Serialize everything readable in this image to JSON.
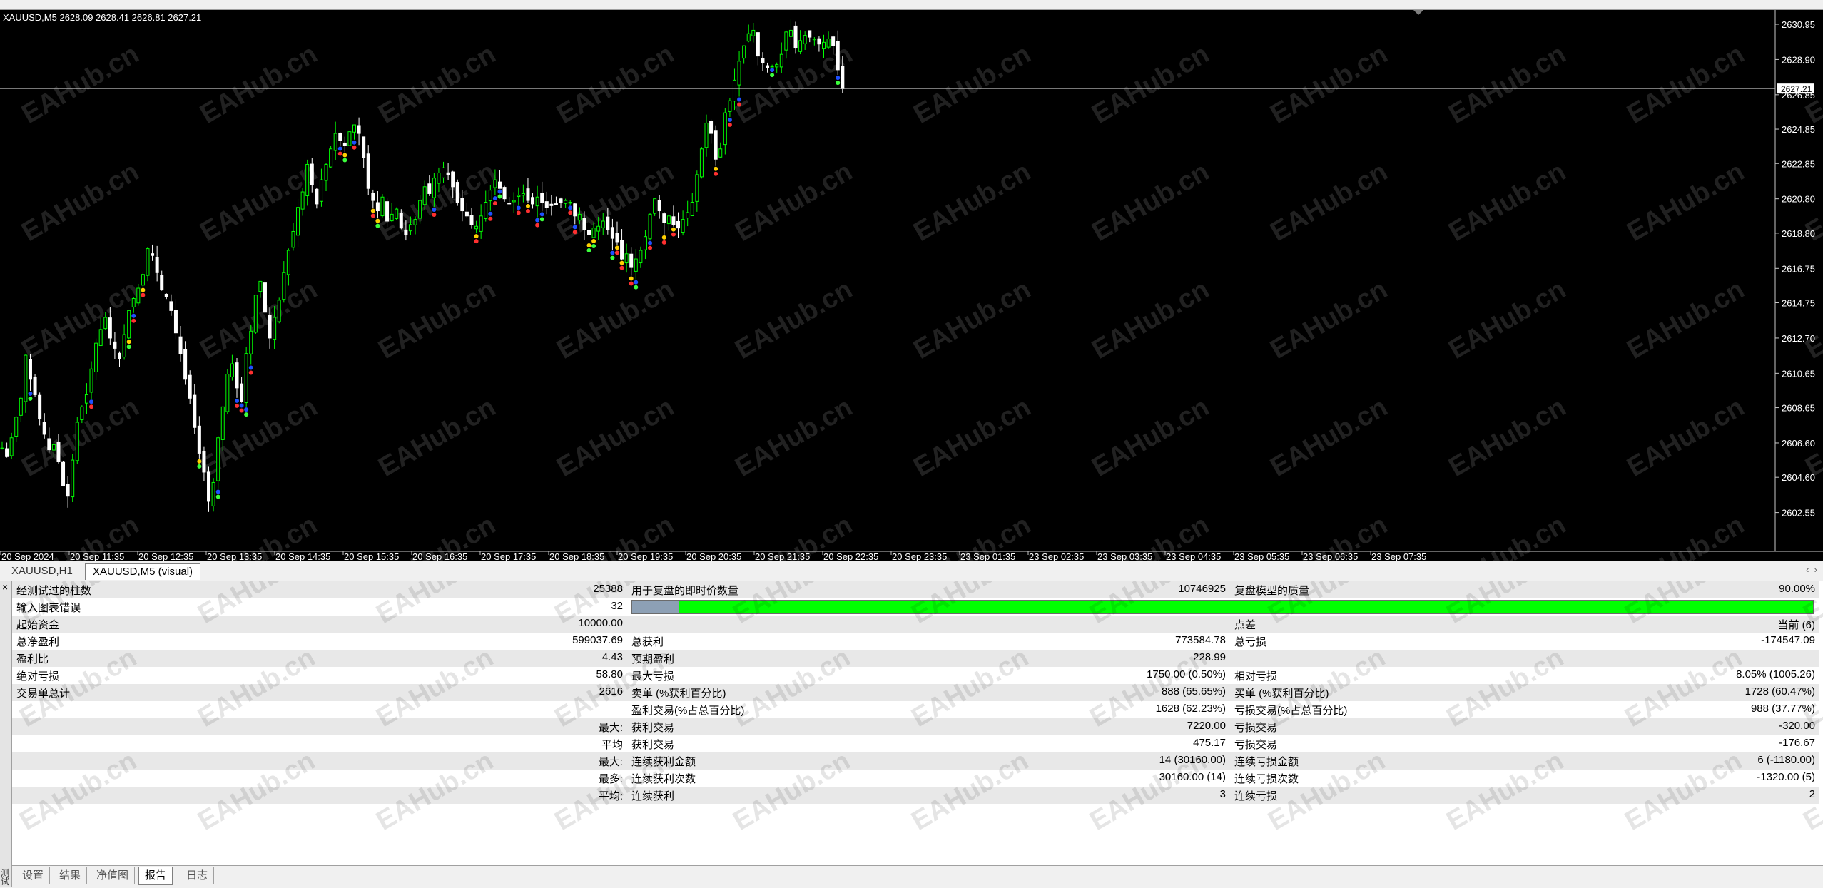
{
  "chart": {
    "symbol_info": "XAUUSD,M5  2628.09 2628.41 2626.81 2627.21",
    "current_price_label": "2627.21",
    "price_axis": [
      "2630.95",
      "2628.90",
      "2626.85",
      "2624.85",
      "2622.85",
      "2620.80",
      "2618.80",
      "2616.75",
      "2614.75",
      "2612.70",
      "2610.65",
      "2608.65",
      "2606.60",
      "2604.60",
      "2602.55"
    ],
    "time_axis": [
      "20 Sep 2024",
      "20 Sep 11:35",
      "20 Sep 12:35",
      "20 Sep 13:35",
      "20 Sep 14:35",
      "20 Sep 15:35",
      "20 Sep 16:35",
      "20 Sep 17:35",
      "20 Sep 18:35",
      "20 Sep 19:35",
      "20 Sep 20:35",
      "20 Sep 21:35",
      "20 Sep 22:35",
      "20 Sep 23:35",
      "23 Sep 01:35",
      "23 Sep 02:35",
      "23 Sep 03:35",
      "23 Sep 04:35",
      "23 Sep 05:35",
      "23 Sep 06:35",
      "23 Sep 07:35"
    ],
    "watermark": "EAHub.cn",
    "colors": {
      "background": "#000000",
      "candle_up": "#00ff00",
      "candle_down": "#ffffff",
      "buy_marker": "#1e50ff",
      "sell_marker": "#ff3030"
    },
    "close_path": [
      2606.3,
      2605.8,
      2606.9,
      2608.1,
      2609.2,
      2611.7,
      2610.3,
      2609.4,
      2608.0,
      2607.1,
      2606.2,
      2606.5,
      2605.5,
      2604.1,
      2603.5,
      2605.6,
      2607.8,
      2608.7,
      2609.4,
      2610.9,
      2612.4,
      2613.2,
      2613.9,
      2612.7,
      2612.1,
      2611.5,
      2612.9,
      2614.3,
      2615.0,
      2615.6,
      2616.4,
      2617.9,
      2617.5,
      2616.5,
      2615.5,
      2615.1,
      2614.3,
      2613.0,
      2611.8,
      2610.3,
      2609.2,
      2607.5,
      2606.0,
      2604.9,
      2603.2,
      2604.3,
      2606.9,
      2608.7,
      2610.6,
      2611.2,
      2609.8,
      2609.0,
      2611.8,
      2613.1,
      2615.2,
      2616.0,
      2614.2,
      2612.7,
      2613.9,
      2614.9,
      2616.5,
      2617.8,
      2618.9,
      2620.3,
      2621.2,
      2622.8,
      2621.6,
      2620.5,
      2621.9,
      2622.8,
      2623.7,
      2624.6,
      2624.2,
      2623.9,
      2624.7,
      2625.1,
      2624.6,
      2623.2,
      2621.4,
      2620.7,
      2620.1,
      2620.9,
      2619.5,
      2619.9,
      2620.2,
      2619.1,
      2618.7,
      2619.3,
      2619.6,
      2620.7,
      2621.5,
      2621.1,
      2622.0,
      2622.3,
      2622.6,
      2622.2,
      2621.5,
      2620.6,
      2620.1,
      2619.8,
      2619.3,
      2619.2,
      2619.8,
      2620.6,
      2621.3,
      2621.9,
      2621.4,
      2620.8,
      2620.5,
      2620.7,
      2621.0,
      2621.1,
      2620.7,
      2620.5,
      2620.9,
      2620.6,
      2620.3,
      2620.4,
      2620.5,
      2620.6,
      2620.7,
      2620.6,
      2619.8,
      2619.9,
      2619.0,
      2618.7,
      2619.1,
      2619.2,
      2619.5,
      2619.0,
      2618.5,
      2618.3,
      2617.3,
      2617.6,
      2616.8,
      2617.3,
      2617.8,
      2618.6,
      2619.9,
      2620.8,
      2620.1,
      2619.4,
      2619.8,
      2619.3,
      2619.1,
      2619.6,
      2620.0,
      2620.6,
      2622.2,
      2623.7,
      2625.2,
      2624.6,
      2623.1,
      2623.7,
      2625.8,
      2626.5,
      2627.7,
      2628.8,
      2629.7,
      2630.4,
      2630.6,
      2629.1,
      2628.7,
      2628.4,
      2628.5,
      2628.6,
      2629.2,
      2630.5,
      2630.6,
      2629.6,
      2630.0,
      2630.3,
      2630.2,
      2630.1,
      2629.8,
      2629.9,
      2630.1,
      2629.7,
      2628.3,
      2627.2
    ]
  },
  "chart_tabs": [
    "XAUUSD,H1",
    "XAUUSD,M5 (visual)"
  ],
  "report": {
    "rows": [
      [
        "经测试过的柱数",
        "25388",
        "用于复盘的即时价数量",
        "10746925",
        "复盘模型的质量",
        "90.00%"
      ],
      [
        "输入图表错误",
        "32",
        "",
        "",
        "",
        ""
      ],
      [
        "起始资金",
        "10000.00",
        "",
        "",
        "点差",
        "当前 (6)"
      ],
      [
        "总净盈利",
        "599037.69",
        "总获利",
        "773584.78",
        "总亏损",
        "-174547.09"
      ],
      [
        "盈利比",
        "4.43",
        "预期盈利",
        "228.99",
        "",
        ""
      ],
      [
        "绝对亏损",
        "58.80",
        "最大亏损",
        "1750.00 (0.50%)",
        "相对亏损",
        "8.05% (1005.26)"
      ],
      [
        "交易单总计",
        "2616",
        "卖单 (%获利百分比)",
        "888 (65.65%)",
        "买单 (%获利百分比)",
        "1728 (60.47%)"
      ],
      [
        "",
        "",
        "盈利交易(%占总百分比)",
        "1628 (62.23%)",
        "亏损交易(%占总百分比)",
        "988 (37.77%)"
      ],
      [
        "",
        "最大:",
        "获利交易",
        "7220.00",
        "亏损交易",
        "-320.00"
      ],
      [
        "",
        "平均",
        "获利交易",
        "475.17",
        "亏损交易",
        "-176.67"
      ],
      [
        "",
        "最大:",
        "连续获利金额",
        "14 (30160.00)",
        "连续亏损金额",
        "6 (-1180.00)"
      ],
      [
        "",
        "最多:",
        "连续获利次数",
        "30160.00 (14)",
        "连续亏损次数",
        "-1320.00 (5)"
      ],
      [
        "",
        "平均:",
        "连续获利",
        "3",
        "连续亏损",
        "2"
      ]
    ],
    "progress_fraction": 0.04,
    "progress_color": "#00ff00"
  },
  "bottom_tabs": [
    "设置",
    "结果",
    "净值图",
    "报告",
    "日志"
  ],
  "side_title": "测试",
  "close_glyph": "×"
}
